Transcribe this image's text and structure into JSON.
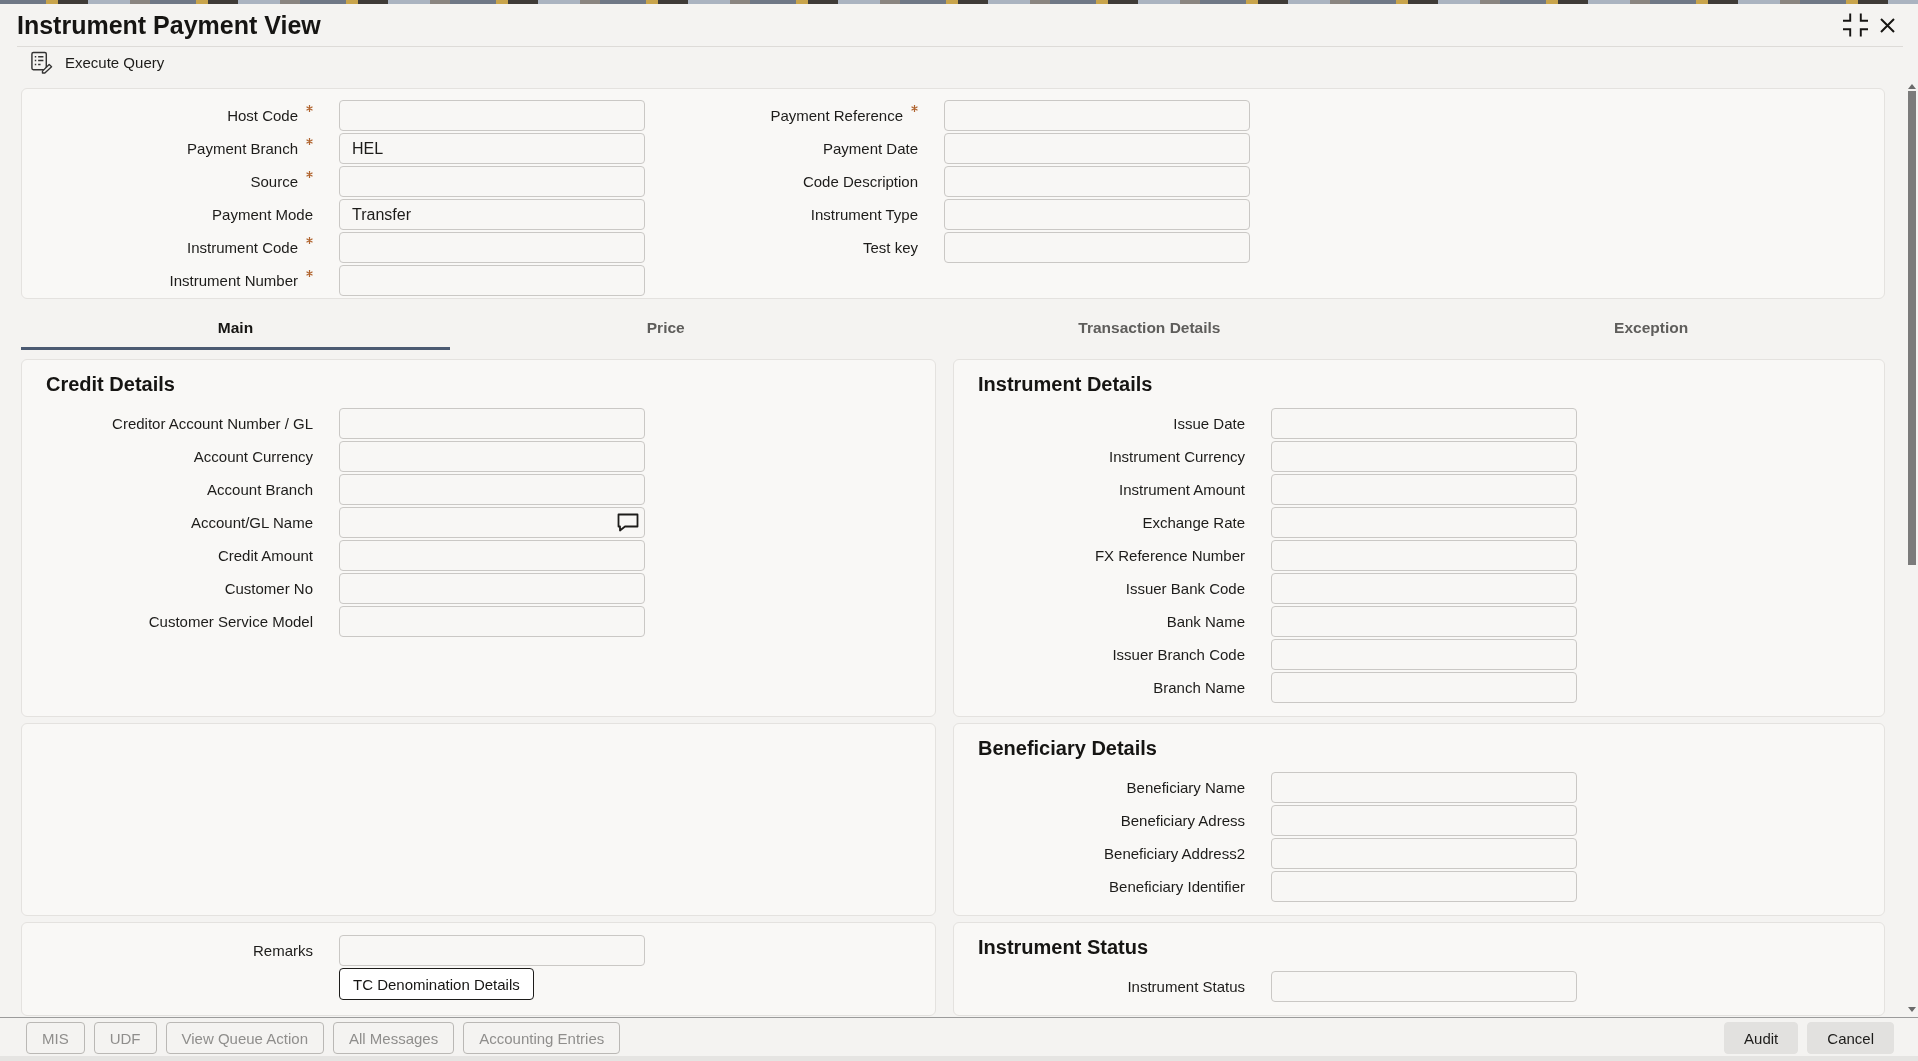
{
  "window": {
    "title": "Instrument Payment View"
  },
  "toolbar": [
    {
      "label": "Execute Query"
    }
  ],
  "header_form": {
    "left_fields": [
      {
        "label": "Host Code",
        "required": true
      },
      {
        "label": "Payment Branch",
        "required": true,
        "value": "HEL"
      },
      {
        "label": "Source",
        "required": true
      },
      {
        "label": "Payment Mode",
        "required": false,
        "value": "Transfer"
      },
      {
        "label": "Instrument Code",
        "required": true
      },
      {
        "label": "Instrument Number",
        "required": true
      }
    ],
    "right_fields": [
      {
        "label": "Payment Reference",
        "required": true
      },
      {
        "label": "Payment Date",
        "required": false
      },
      {
        "label": "Code Description",
        "required": false
      },
      {
        "label": "Instrument Type",
        "required": false
      },
      {
        "label": "Test key",
        "required": false
      }
    ]
  },
  "tabs": [
    {
      "label": "Main",
      "selected": true
    },
    {
      "label": "Price",
      "selected": false
    },
    {
      "label": "Transaction Details",
      "selected": false
    },
    {
      "label": "Exception",
      "selected": false
    }
  ],
  "panels": [
    {
      "kind": "form",
      "title": "Credit Details",
      "fields": [
        {
          "label": "Creditor Account Number / GL",
          "kind": "text"
        },
        {
          "label": "Account Currency",
          "kind": "text"
        },
        {
          "label": "Account Branch",
          "kind": "text"
        },
        {
          "label": "Account/GL Name",
          "kind": "memo"
        },
        {
          "label": "Credit Amount",
          "kind": "text"
        },
        {
          "label": "Customer No",
          "kind": "text"
        },
        {
          "label": "Customer Service Model",
          "kind": "text"
        }
      ]
    },
    {
      "kind": "form",
      "title": "Instrument Details",
      "fields": [
        {
          "label": "Issue Date"
        },
        {
          "label": "Instrument Currency"
        },
        {
          "label": "Instrument Amount"
        },
        {
          "label": "Exchange Rate"
        },
        {
          "label": "FX Reference Number"
        },
        {
          "label": "Issuer Bank Code"
        },
        {
          "label": "Bank Name"
        },
        {
          "label": "Issuer Branch Code"
        },
        {
          "label": "Branch Name"
        }
      ]
    },
    {
      "kind": "blank"
    },
    {
      "kind": "form",
      "title": "Beneficiary Details",
      "fields": [
        {
          "label": "Beneficiary Name"
        },
        {
          "label": "Beneficiary Adress"
        },
        {
          "label": "Beneficiary Address2"
        },
        {
          "label": "Beneficiary Identifier"
        }
      ]
    },
    {
      "kind": "form",
      "fields": [
        {
          "label": "Remarks"
        }
      ],
      "button": {
        "label": "TC Denomination Details"
      }
    },
    {
      "kind": "form",
      "title": "Instrument Status",
      "fields": [
        {
          "label": "Instrument Status"
        }
      ]
    }
  ],
  "footer": {
    "left_buttons": [
      {
        "label": "MIS",
        "disabled": true
      },
      {
        "label": "UDF",
        "disabled": true
      },
      {
        "label": "View Queue Action",
        "disabled": true
      },
      {
        "label": "All Messages",
        "disabled": true
      },
      {
        "label": "Accounting Entries",
        "disabled": true
      }
    ],
    "right_buttons": [
      {
        "label": "Audit",
        "disabled": false
      },
      {
        "label": "Cancel",
        "disabled": false
      }
    ]
  }
}
